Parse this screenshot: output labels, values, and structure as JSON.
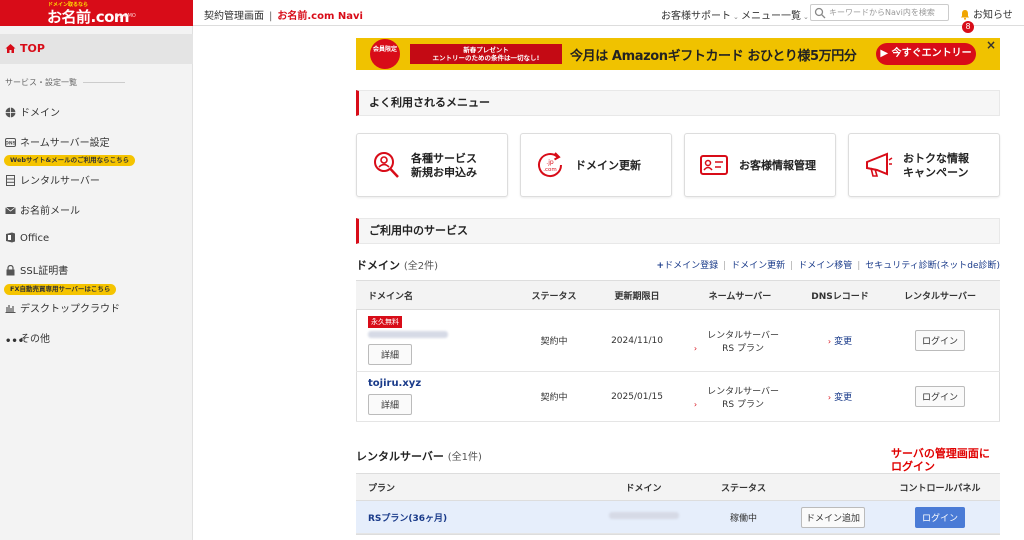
{
  "header": {
    "logo_tag": "ドメイン取るなら",
    "logo_text": "お名前.com",
    "logo_sub": "by GMO",
    "breadcrumb_first": "契約管理画面",
    "breadcrumb_sep": "|",
    "breadcrumb_second": "お名前.com Navi",
    "support": "お客様サポート",
    "menu": "メニュー一覧",
    "search_placeholder": "キーワードからNavi内を検索",
    "notice": "お知らせ",
    "notice_count": "8"
  },
  "sidebar": {
    "top": "TOP",
    "section": "サービス・設定一覧",
    "items": [
      {
        "label": "ドメイン",
        "icon": "globe-icon"
      },
      {
        "label": "ネームサーバー設定",
        "icon": "dns-icon"
      },
      {
        "label": "レンタルサーバー",
        "icon": "server-icon"
      },
      {
        "label": "お名前メール",
        "icon": "mail-icon"
      },
      {
        "label": "Office",
        "icon": "office-icon"
      },
      {
        "label": "SSL証明書",
        "icon": "lock-icon"
      },
      {
        "label": "デスクトップクラウド",
        "icon": "cloud-icon"
      },
      {
        "label": "その他",
        "icon": "more-icon"
      }
    ],
    "tag_web": "Webサイト&メールのご利用ならこちら",
    "tag_fx": "FX自動売買専用サーバーはこちら"
  },
  "banner": {
    "badge": "会員限定",
    "red_line1": "新春プレゼント",
    "red_line2": "エントリーのための条件は一切なし!",
    "main": "今月は Amazonギフトカード おひとり様5万円分",
    "button": "今すぐエントリー",
    "close": "×"
  },
  "menu_section": {
    "title": "よく利用されるメニュー",
    "cards": [
      {
        "line1": "各種サービス",
        "line2": "新規お申込み"
      },
      {
        "line1": "ドメイン更新",
        "line2": ""
      },
      {
        "line1": "お客様情報管理",
        "line2": ""
      },
      {
        "line1": "おトクな情報",
        "line2": "キャンペーン"
      }
    ]
  },
  "services_section": {
    "title": "ご利用中のサービス"
  },
  "domain": {
    "title": "ドメイン",
    "count": "(全2件)",
    "links": [
      "ドメイン登録",
      "ドメイン更新",
      "ドメイン移管",
      "セキュリティ診断(ネットde診断)"
    ],
    "columns": [
      "ドメイン名",
      "ステータス",
      "更新期限日",
      "ネームサーバー",
      "DNSレコード",
      "レンタルサーバー"
    ],
    "rows": [
      {
        "tag": "永久無料",
        "name": "",
        "detail": "詳細",
        "status": "契約中",
        "expiry": "2024/11/10",
        "ns": "レンタルサーバー RS プラン",
        "dns": "変更",
        "server": "ログイン"
      },
      {
        "tag": "",
        "name": "tojiru.xyz",
        "detail": "詳細",
        "status": "契約中",
        "expiry": "2025/01/15",
        "ns": "レンタルサーバー RS プラン",
        "dns": "変更",
        "server": "ログイン"
      }
    ]
  },
  "server": {
    "title": "レンタルサーバー",
    "count": "(全1件)",
    "columns": [
      "プラン",
      "ドメイン",
      "ステータス",
      "",
      "コントロールパネル"
    ],
    "row": {
      "plan": "RSプラン(36ヶ月)",
      "status": "稼働中",
      "add_domain": "ドメイン追加",
      "login": "ログイン"
    }
  },
  "annotation": {
    "line1": "サーバの管理画面に",
    "line2": "ログイン"
  },
  "colors": {
    "brand": "#d80c18",
    "link": "#1a3b8a",
    "accent_blue": "#4a7bd6"
  }
}
